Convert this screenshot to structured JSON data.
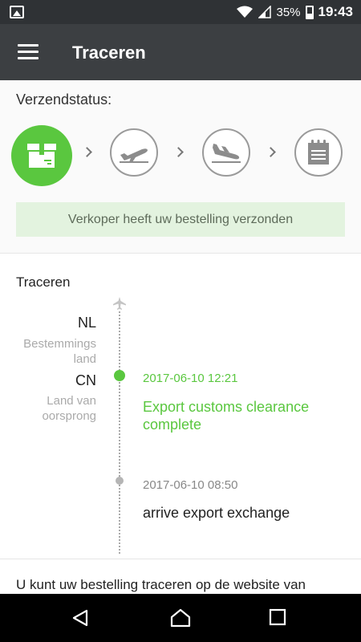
{
  "status_bar": {
    "battery": "35%",
    "time": "19:43",
    "icons": [
      "image-icon",
      "wifi-icon",
      "signal-icon",
      "battery-icon"
    ]
  },
  "app_bar": {
    "title": "Traceren",
    "menu_icon": "hamburger-menu-icon"
  },
  "shipment_status": {
    "label": "Verzendstatus:",
    "steps": [
      {
        "icon": "package-icon",
        "state": "active"
      },
      {
        "icon": "plane-takeoff-icon",
        "state": "inactive"
      },
      {
        "icon": "plane-landing-icon",
        "state": "inactive"
      },
      {
        "icon": "delivered-notepad-icon",
        "state": "inactive"
      }
    ],
    "message": "Verkoper heeft uw bestelling verzonden"
  },
  "tracking": {
    "heading": "Traceren",
    "destination": {
      "code": "NL",
      "label": "Bestemmings land"
    },
    "origin": {
      "code": "CN",
      "label": "Land van oorsprong"
    },
    "events": [
      {
        "time": "2017-06-10 12:21",
        "description": "Export customs clearance complete",
        "state": "current"
      },
      {
        "time": "2017-06-10 08:50",
        "description": "arrive export exchange",
        "state": "past"
      }
    ]
  },
  "footer_text": "U kunt uw bestelling traceren op de website van",
  "colors": {
    "accent_green": "#5ac73f",
    "app_bar": "#3c3f42",
    "status_bar": "#2f3235",
    "notice_bg": "#e3f3df"
  },
  "nav_bar": {
    "buttons": [
      "back-icon",
      "home-icon",
      "recents-icon"
    ]
  }
}
